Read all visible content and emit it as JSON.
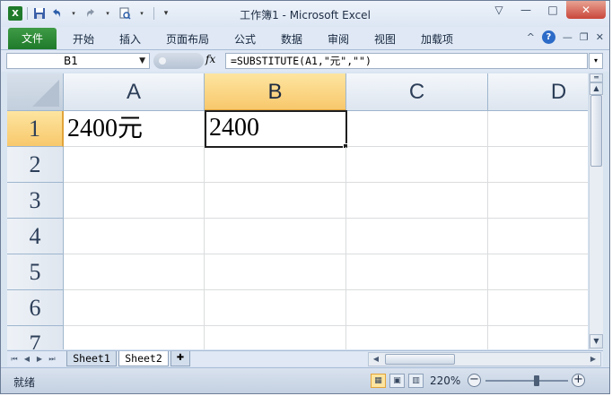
{
  "window": {
    "title": "工作簿1 - Microsoft Excel",
    "controls": [
      "▽",
      "—",
      "□",
      "✕"
    ]
  },
  "quick_access": {
    "app_icon": "X",
    "save_icon": "save-icon",
    "undo_icon": "undo-icon",
    "redo_icon": "redo-icon",
    "preview_icon": "print-preview-icon"
  },
  "ribbon": {
    "file_tab": "文件",
    "tabs": [
      "开始",
      "插入",
      "页面布局",
      "公式",
      "数据",
      "审阅",
      "视图",
      "加载项"
    ],
    "right_icons": [
      "^",
      "?",
      "—",
      "❐",
      "✕"
    ]
  },
  "formula_bar": {
    "name_box": "B1",
    "fx_label": "fx",
    "formula": "=SUBSTITUTE(A1,\"元\",\"\")"
  },
  "grid": {
    "columns": [
      "A",
      "B",
      "C",
      "D"
    ],
    "rows": [
      "1",
      "2",
      "3",
      "4",
      "5",
      "6",
      "7"
    ],
    "cells": {
      "A1": "2400元",
      "B1": "2400"
    },
    "selected_cell": "B1"
  },
  "sheets": {
    "tabs": [
      "Sheet1",
      "Sheet2"
    ],
    "active": "Sheet2"
  },
  "status_bar": {
    "ready": "就绪",
    "zoom": "220%",
    "zoom_fraction": 0.62
  },
  "colors": {
    "file_tab": "#1f7a2a",
    "selection_header": "#f8c86c",
    "header_text": "#2c3e58"
  }
}
